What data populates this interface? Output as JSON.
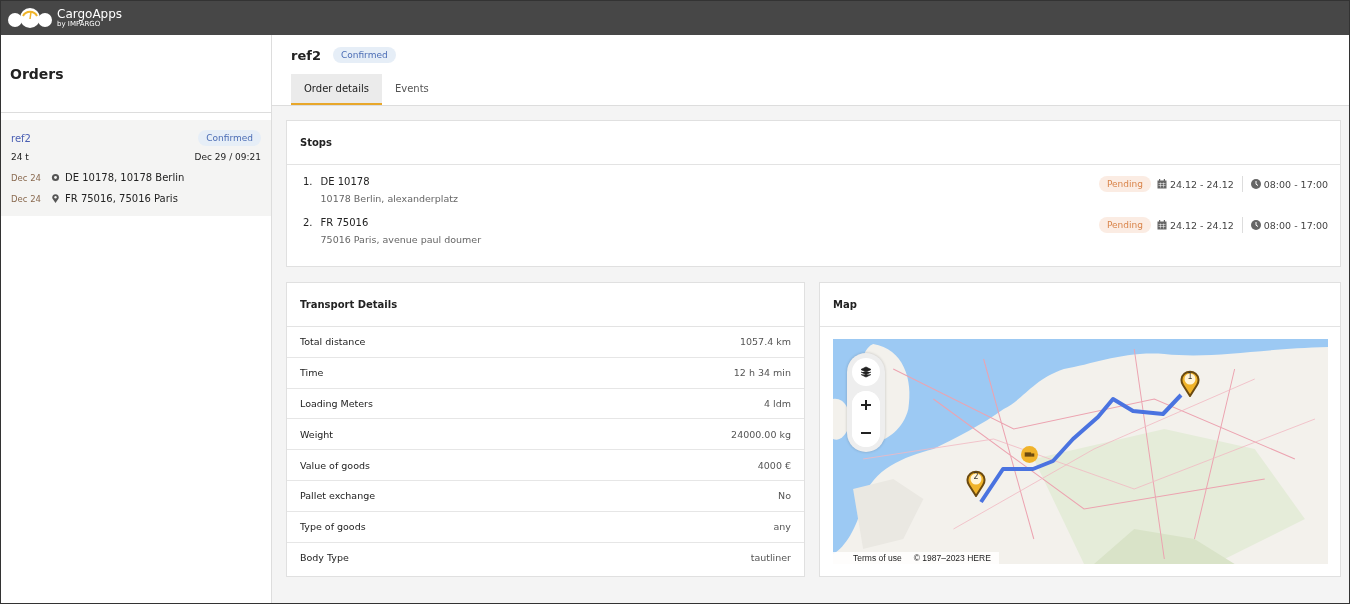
{
  "header": {
    "brand": "CargoApps",
    "subbrand": "by IMPARGO"
  },
  "sidebar": {
    "title": "Orders",
    "orders": [
      {
        "ref": "ref2",
        "status": "Confirmed",
        "selected": true,
        "weight": "24 t",
        "datetime": "Dec 29 / 09:21",
        "stops": [
          {
            "kind": "origin",
            "date": "Dec 24",
            "place": "DE 10178, 10178 Berlin"
          },
          {
            "kind": "destination",
            "date": "Dec 24",
            "place": "FR 75016, 75016 Paris"
          }
        ]
      }
    ]
  },
  "order": {
    "ref": "ref2",
    "status": "Confirmed"
  },
  "tabs": [
    {
      "label": "Order details",
      "selected": true
    },
    {
      "label": "Events",
      "selected": false
    }
  ],
  "stops": {
    "title": "Stops",
    "items": [
      {
        "number": "1.",
        "code": "DE 10178",
        "address": "10178 Berlin, alexanderplatz",
        "status": "Pending",
        "dates": "24.12 - 24.12",
        "time": "08:00 - 17:00"
      },
      {
        "number": "2.",
        "code": "FR 75016",
        "address": "75016 Paris, avenue paul doumer",
        "status": "Pending",
        "dates": "24.12 - 24.12",
        "time": "08:00 - 17:00"
      }
    ]
  },
  "transport": {
    "title": "Transport Details",
    "rows": [
      {
        "label": "Total distance",
        "value": "1057.4 km"
      },
      {
        "label": "Time",
        "value": "12 h 34 min"
      },
      {
        "label": "Loading Meters",
        "value": "4 ldm"
      },
      {
        "label": "Weight",
        "value": "24000.00 kg"
      },
      {
        "label": "Value of goods",
        "value": "4000 €"
      },
      {
        "label": "Pallet exchange",
        "value": "No"
      },
      {
        "label": "Type of goods",
        "value": "any"
      },
      {
        "label": "Body Type",
        "value": "tautliner"
      }
    ]
  },
  "map": {
    "title": "Map",
    "markers": [
      {
        "label": "1"
      },
      {
        "label": "2"
      }
    ],
    "terms": "Terms of use",
    "copyright": "© 1987–2023 HERE"
  }
}
